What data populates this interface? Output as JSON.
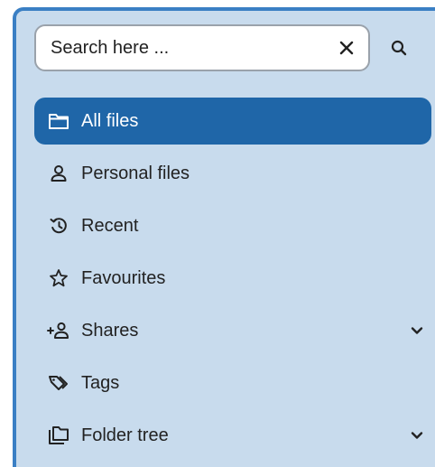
{
  "search": {
    "placeholder": "Search here ...",
    "clear_icon": "close-icon",
    "submit_icon": "search-icon"
  },
  "nav": {
    "items": [
      {
        "label": "All files",
        "icon": "folder-icon",
        "active": true
      },
      {
        "label": "Personal files",
        "icon": "person-icon"
      },
      {
        "label": "Recent",
        "icon": "history-icon"
      },
      {
        "label": "Favourites",
        "icon": "star-icon"
      },
      {
        "label": "Shares",
        "icon": "share-user-icon",
        "expandable": true
      },
      {
        "label": "Tags",
        "icon": "tag-icon"
      },
      {
        "label": "Folder tree",
        "icon": "folder-tree-icon",
        "expandable": true
      }
    ]
  },
  "colors": {
    "sidebar_bg": "#c8dbed",
    "accent": "#1f66a8",
    "frame": "#3a7fc4"
  }
}
